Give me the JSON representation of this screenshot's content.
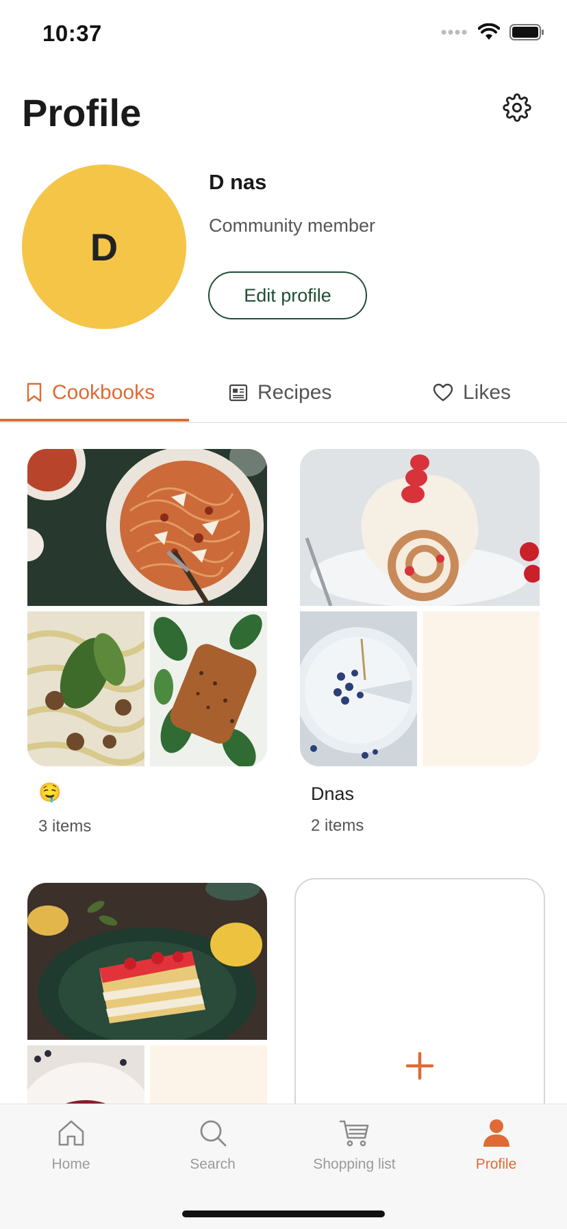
{
  "status_bar": {
    "time": "10:37"
  },
  "header": {
    "title": "Profile"
  },
  "profile": {
    "initial": "D",
    "name": "D nas",
    "role": "Community member",
    "edit_label": "Edit profile",
    "avatar_color": "#f5c548"
  },
  "tabs": [
    {
      "label": "Cookbooks",
      "active": true
    },
    {
      "label": "Recipes",
      "active": false
    },
    {
      "label": "Likes",
      "active": false
    }
  ],
  "cookbooks": [
    {
      "title": "🤤",
      "count": "3 items",
      "images": [
        "spaghetti-bolognese",
        "mushroom-pasta-basil",
        "seared-salmon-greens"
      ]
    },
    {
      "title": "Dnas",
      "count": "2 items",
      "images": [
        "strawberry-swiss-roll",
        "blueberry-cheesecake"
      ]
    },
    {
      "title": "",
      "count": "",
      "images": [
        "strawberry-layer-cake",
        "berry-dessert"
      ]
    }
  ],
  "bottom_nav": [
    {
      "label": "Home",
      "icon": "home-icon",
      "active": false
    },
    {
      "label": "Search",
      "icon": "search-icon",
      "active": false
    },
    {
      "label": "Shopping list",
      "icon": "cart-icon",
      "active": false
    },
    {
      "label": "Profile",
      "icon": "person-icon",
      "active": true
    }
  ],
  "colors": {
    "accent": "#e06a35",
    "brand_green": "#1f4d34",
    "empty_tile": "#fdf4e9"
  }
}
